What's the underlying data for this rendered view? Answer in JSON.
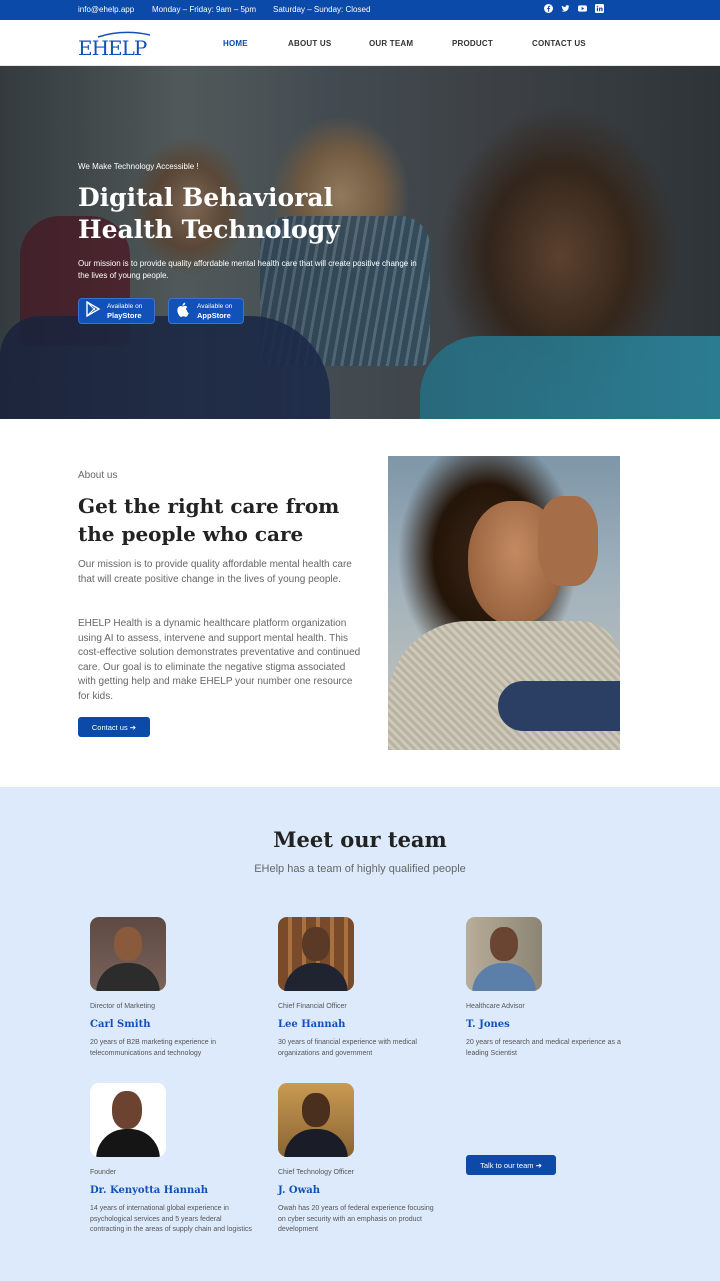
{
  "topbar": {
    "email": "info@ehelp.app",
    "weekday_hours": "Monday – Friday: 9am – 5pm",
    "weekend_hours": "Saturday – Sunday: Closed",
    "social_icons": [
      "facebook-icon",
      "twitter-icon",
      "youtube-icon",
      "linkedin-icon"
    ]
  },
  "header": {
    "logo_text": "EHELP",
    "nav": [
      "HOME",
      "ABOUT US",
      "OUR TEAM",
      "PRODUCT",
      "CONTACT US"
    ],
    "active_nav": "HOME"
  },
  "hero": {
    "tagline": "We Make Technology Accessible !",
    "title": "Digital Behavioral Health Technology",
    "description": "Our mission is to provide quality affordable mental health care that will create positive change in the lives of young people.",
    "playstore": {
      "small": "Available on",
      "big": "PlayStore"
    },
    "appstore": {
      "small": "Available on",
      "big": "AppStore"
    }
  },
  "about": {
    "eyebrow": "About us",
    "title": "Get the right care from the people who care",
    "paragraph1": "Our mission is to provide quality affordable mental health care that will create positive change in the lives of young people.",
    "paragraph2": "EHELP Health is a dynamic healthcare platform organization using AI to assess, intervene and support mental health. This cost-effective solution demonstrates preventative and continued care. Our goal is to eliminate the negative stigma associated with getting help and make EHELP your number one resource for kids.",
    "button": "Contact us ➔"
  },
  "team": {
    "title": "Meet our team",
    "subtitle": "EHelp has a team of highly qualified people",
    "members": [
      {
        "role": "Director of Marketing",
        "name": "Carl Smith",
        "desc": "20 years of B2B marketing experience in telecommunications and technology"
      },
      {
        "role": "Chief Financial Officer",
        "name": "Lee Hannah",
        "desc": "30 years of financial experience with medical organizations and government"
      },
      {
        "role": "Healthcare Advisor",
        "name": "T. Jones",
        "desc": "20 years of research and medical experience as a leading Scientist"
      },
      {
        "role": "Founder",
        "name": "Dr. Kenyotta Hannah",
        "desc": "14 years of international global experience in psychological services and 5 years federal contracting in the areas of supply chain and logistics"
      },
      {
        "role": "Chief Technology Officer",
        "name": "J. Owah",
        "desc": "Owah has 20 years of federal experience focusing on cyber security with an emphasis on product development"
      }
    ],
    "button": "Talk to our team ➔"
  },
  "colors": {
    "brand_blue": "#0b4aa8",
    "team_bg": "#dceafb",
    "name_blue": "#1251b8"
  }
}
